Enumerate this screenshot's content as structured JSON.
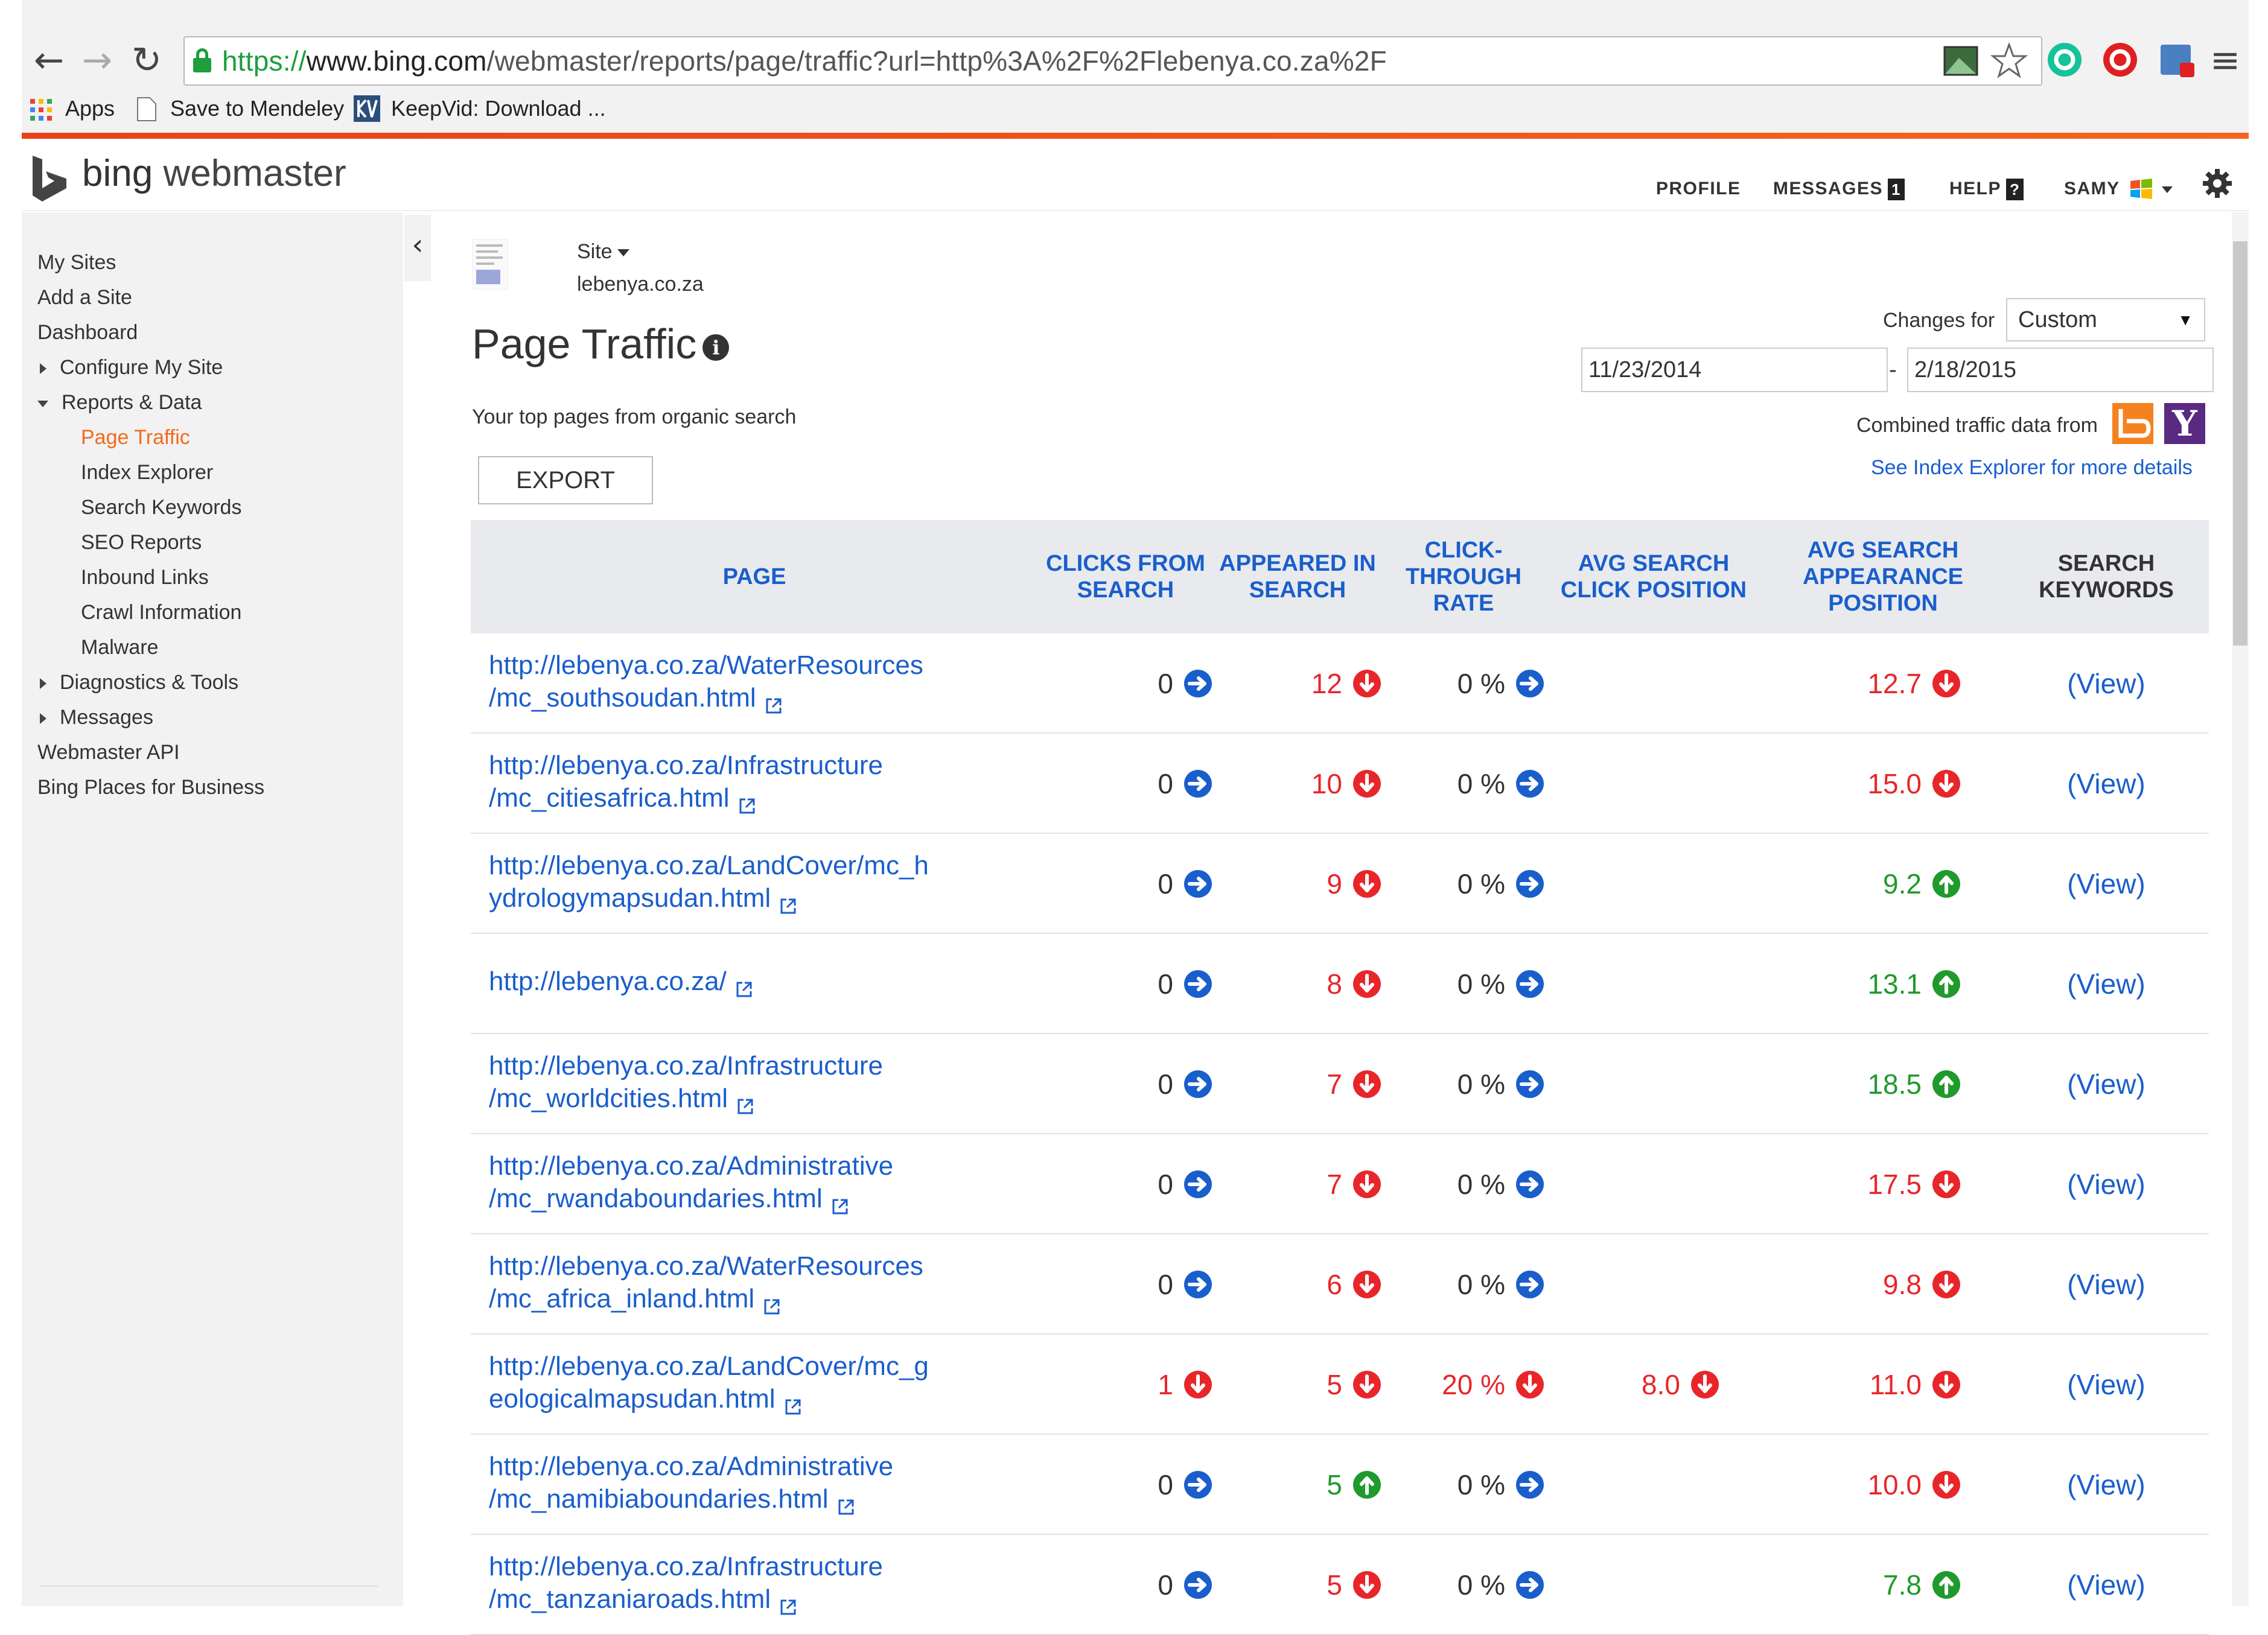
{
  "browser": {
    "url_scheme": "https://",
    "url_host": "www.bing.com",
    "url_path": "/webmaster/reports/page/traffic?url=http%3A%2F%2Flebenya.co.za%2F",
    "bookmarks": [
      "Apps",
      "Save to Mendeley",
      "KeepVid: Download ..."
    ]
  },
  "header": {
    "logo_bing": "bing",
    "logo_webmaster": "webmaster",
    "profile": "PROFILE",
    "messages": "MESSAGES",
    "messages_count": "1",
    "help": "HELP",
    "help_badge": "?",
    "user": "SAMY"
  },
  "sidebar": {
    "items": [
      {
        "label": "My Sites"
      },
      {
        "label": "Add a Site"
      },
      {
        "label": "Dashboard"
      },
      {
        "label": "Configure My Site"
      },
      {
        "label": "Reports & Data"
      },
      {
        "label": "Page Traffic"
      },
      {
        "label": "Index Explorer"
      },
      {
        "label": "Search Keywords"
      },
      {
        "label": "SEO Reports"
      },
      {
        "label": "Inbound Links"
      },
      {
        "label": "Crawl Information"
      },
      {
        "label": "Malware"
      },
      {
        "label": "Diagnostics & Tools"
      },
      {
        "label": "Messages"
      },
      {
        "label": "Webmaster API"
      },
      {
        "label": "Bing Places for Business"
      }
    ],
    "collapse_glyph": "‹"
  },
  "site": {
    "label": "Site",
    "name": "lebenya.co.za"
  },
  "page": {
    "title": "Page Traffic",
    "info": "i",
    "subtitle": "Your top pages from organic search",
    "export": "EXPORT",
    "changes_for_label": "Changes for",
    "changes_for_value": "Custom",
    "date_from": "11/23/2014",
    "date_sep": "-",
    "date_to": "2/18/2015",
    "combined_label": "Combined traffic data from",
    "yahoo_letter": "Y",
    "index_link": "See Index Explorer for more details"
  },
  "colors": {
    "up": "#1f9a2c",
    "down": "#e8262a",
    "link": "#1a5ecc",
    "active_nav": "#f26b1d"
  },
  "table": {
    "columns": {
      "page": "PAGE",
      "clicks": [
        "CLICKS FROM",
        "SEARCH"
      ],
      "appeared": [
        "APPEARED IN",
        "SEARCH"
      ],
      "ctr": [
        "CLICK-",
        "THROUGH",
        "RATE"
      ],
      "avg_click": [
        "AVG SEARCH",
        "CLICK POSITION"
      ],
      "avg_appear": [
        "AVG SEARCH",
        "APPEARANCE",
        "POSITION"
      ],
      "keywords": [
        "SEARCH",
        "KEYWORDS"
      ]
    },
    "rows": [
      {
        "page": [
          "http://lebenya.co.za/WaterResources",
          "/mc_southsoudan.html"
        ],
        "clicks": "0",
        "clicks_trend": "flat",
        "appeared": "12",
        "appeared_trend": "down",
        "ctr": "0 %",
        "ctr_trend": "flat",
        "avg_click": "",
        "avg_click_trend": "",
        "avg_appear": "12.7",
        "avg_appear_trend": "down",
        "keywords": "(View)"
      },
      {
        "page": [
          "http://lebenya.co.za/Infrastructure",
          "/mc_citiesafrica.html"
        ],
        "clicks": "0",
        "clicks_trend": "flat",
        "appeared": "10",
        "appeared_trend": "down",
        "ctr": "0 %",
        "ctr_trend": "flat",
        "avg_click": "",
        "avg_click_trend": "",
        "avg_appear": "15.0",
        "avg_appear_trend": "down",
        "keywords": "(View)"
      },
      {
        "page": [
          "http://lebenya.co.za/LandCover/mc_h",
          "ydrologymapsudan.html"
        ],
        "clicks": "0",
        "clicks_trend": "flat",
        "appeared": "9",
        "appeared_trend": "down",
        "ctr": "0 %",
        "ctr_trend": "flat",
        "avg_click": "",
        "avg_click_trend": "",
        "avg_appear": "9.2",
        "avg_appear_trend": "up",
        "keywords": "(View)"
      },
      {
        "page": [
          "http://lebenya.co.za/",
          ""
        ],
        "clicks": "0",
        "clicks_trend": "flat",
        "appeared": "8",
        "appeared_trend": "down",
        "ctr": "0 %",
        "ctr_trend": "flat",
        "avg_click": "",
        "avg_click_trend": "",
        "avg_appear": "13.1",
        "avg_appear_trend": "up",
        "keywords": "(View)"
      },
      {
        "page": [
          "http://lebenya.co.za/Infrastructure",
          "/mc_worldcities.html"
        ],
        "clicks": "0",
        "clicks_trend": "flat",
        "appeared": "7",
        "appeared_trend": "down",
        "ctr": "0 %",
        "ctr_trend": "flat",
        "avg_click": "",
        "avg_click_trend": "",
        "avg_appear": "18.5",
        "avg_appear_trend": "up",
        "keywords": "(View)"
      },
      {
        "page": [
          "http://lebenya.co.za/Administrative",
          "/mc_rwandaboundaries.html"
        ],
        "clicks": "0",
        "clicks_trend": "flat",
        "appeared": "7",
        "appeared_trend": "down",
        "ctr": "0 %",
        "ctr_trend": "flat",
        "avg_click": "",
        "avg_click_trend": "",
        "avg_appear": "17.5",
        "avg_appear_trend": "down",
        "keywords": "(View)"
      },
      {
        "page": [
          "http://lebenya.co.za/WaterResources",
          "/mc_africa_inland.html"
        ],
        "clicks": "0",
        "clicks_trend": "flat",
        "appeared": "6",
        "appeared_trend": "down",
        "ctr": "0 %",
        "ctr_trend": "flat",
        "avg_click": "",
        "avg_click_trend": "",
        "avg_appear": "9.8",
        "avg_appear_trend": "down",
        "keywords": "(View)"
      },
      {
        "page": [
          "http://lebenya.co.za/LandCover/mc_g",
          "eologicalmapsudan.html"
        ],
        "clicks": "1",
        "clicks_trend": "down",
        "appeared": "5",
        "appeared_trend": "down",
        "ctr": "20 %",
        "ctr_trend": "down",
        "avg_click": "8.0",
        "avg_click_trend": "down",
        "avg_appear": "11.0",
        "avg_appear_trend": "down",
        "keywords": "(View)"
      },
      {
        "page": [
          "http://lebenya.co.za/Administrative",
          "/mc_namibiaboundaries.html"
        ],
        "clicks": "0",
        "clicks_trend": "flat",
        "appeared": "5",
        "appeared_trend": "up",
        "ctr": "0 %",
        "ctr_trend": "flat",
        "avg_click": "",
        "avg_click_trend": "",
        "avg_appear": "10.0",
        "avg_appear_trend": "down",
        "keywords": "(View)"
      },
      {
        "page": [
          "http://lebenya.co.za/Infrastructure",
          "/mc_tanzaniaroads.html"
        ],
        "clicks": "0",
        "clicks_trend": "flat",
        "appeared": "5",
        "appeared_trend": "down",
        "ctr": "0 %",
        "ctr_trend": "flat",
        "avg_click": "",
        "avg_click_trend": "",
        "avg_appear": "7.8",
        "avg_appear_trend": "up",
        "keywords": "(View)"
      }
    ]
  }
}
